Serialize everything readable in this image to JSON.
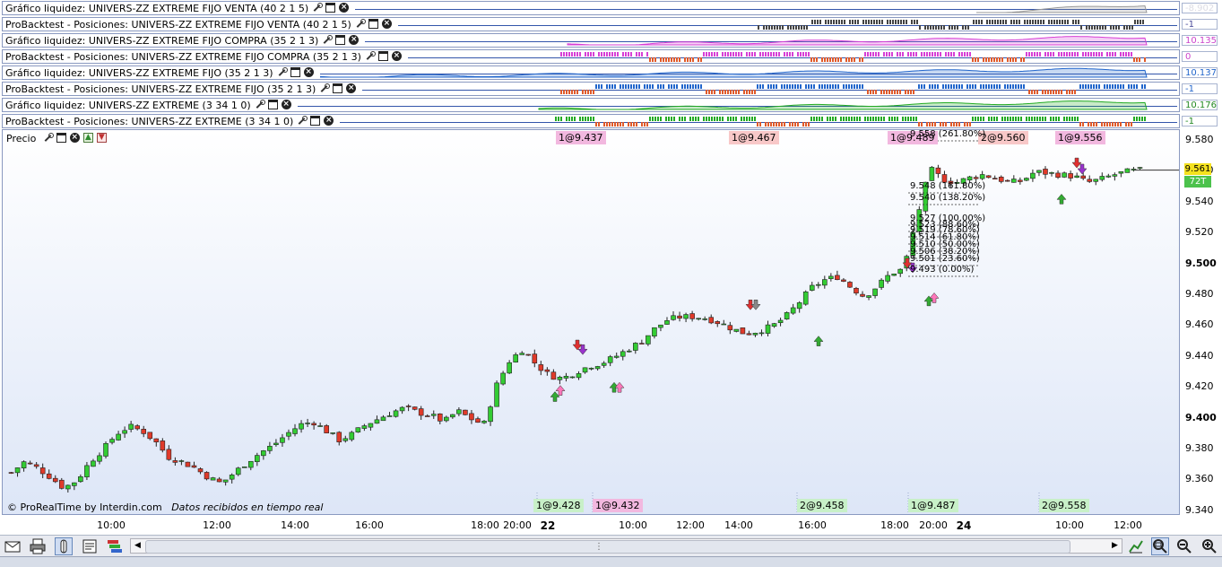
{
  "panels": [
    {
      "title": "Gráfico liquidez: UNIVERS-ZZ EXTREME FIJO VENTA (40 2 1 5)",
      "value": "-8.902",
      "value_color": "#dcdce4",
      "value_bg": "#ffffff"
    },
    {
      "title": "ProBacktest - Posiciones: UNIVERS-ZZ EXTREME FIJO VENTA (40 2 1 5)",
      "value": "-1",
      "value_color": "#4a4a9a",
      "value_bg": "#ffffff"
    },
    {
      "title": "Gráfico liquidez: UNIVERS-ZZ EXTREME FIJO COMPRA (35 2 1 3)",
      "value": "10.135",
      "value_color": "#cc44cc",
      "value_bg": "#ffffff"
    },
    {
      "title": "ProBacktest - Posiciones: UNIVERS-ZZ EXTREME FIJO COMPRA (35 2 1 3)",
      "value": "0",
      "value_color": "#cc44cc",
      "value_bg": "#ffffff"
    },
    {
      "title": "Gráfico liquidez: UNIVERS-ZZ EXTREME FIJO (35 2 1 3)",
      "value": "10.137",
      "value_color": "#2266cc",
      "value_bg": "#ffffff"
    },
    {
      "title": "ProBacktest - Posiciones: UNIVERS-ZZ EXTREME FIJO (35 2 1 3)",
      "value": "-1",
      "value_color": "#2266cc",
      "value_bg": "#ffffff"
    },
    {
      "title": "Gráfico liquidez: UNIVERS-ZZ EXTREME (3 34 1 0)",
      "value": "10.176",
      "value_color": "#228822",
      "value_bg": "#ffffff"
    },
    {
      "title": "ProBacktest - Posiciones: UNIVERS-ZZ EXTREME (3 34 1 0)",
      "value": "-1",
      "value_color": "#228822",
      "value_bg": "#ffffff"
    }
  ],
  "price_panel": {
    "title": "Precio"
  },
  "price_axis": {
    "ticks": [
      "9.580",
      "9.560",
      "9.540",
      "9.520",
      "9.500",
      "9.480",
      "9.460",
      "9.440",
      "9.420",
      "9.400",
      "9.380",
      "9.360",
      "9.340"
    ],
    "bold_ticks": [
      "9.500",
      "9.400"
    ],
    "current_price": "9.561",
    "current_price_bg": "#f4e11e",
    "volume_badge": "72T",
    "volume_badge_bg": "#4cc24c"
  },
  "time_axis": {
    "ticks": [
      {
        "label": "10:00",
        "bold": false
      },
      {
        "label": "12:00",
        "bold": false
      },
      {
        "label": "14:00",
        "bold": false
      },
      {
        "label": "16:00",
        "bold": false
      },
      {
        "label": "18:00",
        "bold": false
      },
      {
        "label": "20:00",
        "bold": false
      },
      {
        "label": "22",
        "bold": true
      },
      {
        "label": "10:00",
        "bold": false
      },
      {
        "label": "12:00",
        "bold": false
      },
      {
        "label": "14:00",
        "bold": false
      },
      {
        "label": "16:00",
        "bold": false
      },
      {
        "label": "18:00",
        "bold": false
      },
      {
        "label": "20:00",
        "bold": false
      },
      {
        "label": "24",
        "bold": true
      },
      {
        "label": "10:00",
        "bold": false
      },
      {
        "label": "12:00",
        "bold": false
      }
    ]
  },
  "trade_labels_top": [
    {
      "text": "1@9.437",
      "style": "pink"
    },
    {
      "text": "1@9.467",
      "style": "red"
    },
    {
      "text": "1@9.489",
      "style": "pink"
    },
    {
      "text": "2@9.560",
      "style": "red"
    },
    {
      "text": "1@9.556",
      "style": "pink"
    }
  ],
  "trade_labels_bottom": [
    {
      "text": "1@9.428",
      "style": "green"
    },
    {
      "text": "1@9.432",
      "style": "pink"
    },
    {
      "text": "2@9.458",
      "style": "green"
    },
    {
      "text": "1@9.487",
      "style": "green"
    },
    {
      "text": "2@9.558",
      "style": "green"
    }
  ],
  "fibonacci_labels": [
    "9.558 (261.80%)",
    "9.548 (161.80%)",
    "9.540 (138.20%)",
    "9.527 (100.00%)",
    "9.523 (88.60%)",
    "9.519 (78.60%)",
    "9.514 (61.80%)",
    "9.510 (50.00%)",
    "9.506 (38.20%)",
    "9.501 (23.60%)",
    "9.493 (0.00%)"
  ],
  "credit": {
    "brand": "© ProRealTime by Interdin.com",
    "note": "Datos recibidos en tiempo real"
  },
  "toolbar": {
    "left_icons": [
      "envelope-icon",
      "printer-icon",
      "cursor-icon",
      "document-icon",
      "layers-icon"
    ],
    "right_icons": [
      "chart-tool-icon",
      "zoom-select-icon",
      "zoom-out-icon",
      "zoom-in-icon"
    ],
    "scroll_left": "◀",
    "scroll_right": "▶",
    "scroll_grip": "⋮"
  },
  "chart_data": {
    "type": "candlestick",
    "title": "Precio",
    "ylim": [
      9.34,
      9.59
    ],
    "x": [
      "10:00",
      "12:00",
      "14:00",
      "16:00",
      "18:00",
      "20:00",
      "22",
      "10:00",
      "12:00",
      "14:00",
      "16:00",
      "18:00",
      "20:00",
      "24",
      "10:00",
      "12:00"
    ],
    "price_path": [
      9.365,
      9.372,
      9.368,
      9.362,
      9.355,
      9.36,
      9.372,
      9.38,
      9.39,
      9.395,
      9.392,
      9.385,
      9.375,
      9.372,
      9.368,
      9.362,
      9.358,
      9.365,
      9.372,
      9.378,
      9.383,
      9.39,
      9.396,
      9.398,
      9.392,
      9.386,
      9.39,
      9.396,
      9.4,
      9.404,
      9.407,
      9.404,
      9.402,
      9.398,
      9.405,
      9.4,
      9.396,
      9.422,
      9.438,
      9.445,
      9.435,
      9.428,
      9.426,
      9.43,
      9.434,
      9.436,
      9.44,
      9.445,
      9.45,
      9.458,
      9.464,
      9.466,
      9.466,
      9.465,
      9.462,
      9.458,
      9.455,
      9.457,
      9.46,
      9.466,
      9.475,
      9.485,
      9.49,
      9.492,
      9.485,
      9.479,
      9.486,
      9.494,
      9.497,
      9.53,
      9.562,
      9.555,
      9.553,
      9.556,
      9.558,
      9.556,
      9.553,
      9.554,
      9.56,
      9.559,
      9.558,
      9.557,
      9.553,
      9.555,
      9.558,
      9.56,
      9.561
    ]
  }
}
